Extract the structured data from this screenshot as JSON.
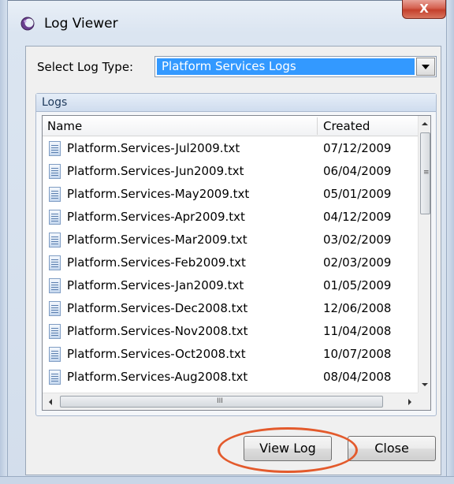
{
  "window": {
    "title": "Log Viewer",
    "close_glyph": "X"
  },
  "selector": {
    "label": "Select Log Type:",
    "selected": "Platform Services Logs"
  },
  "logs_group": {
    "title": "Logs",
    "columns": {
      "name": "Name",
      "created": "Created"
    },
    "rows": [
      {
        "name": "Platform.Services-Jul2009.txt",
        "created": "07/12/2009"
      },
      {
        "name": "Platform.Services-Jun2009.txt",
        "created": "06/04/2009"
      },
      {
        "name": "Platform.Services-May2009.txt",
        "created": "05/01/2009"
      },
      {
        "name": "Platform.Services-Apr2009.txt",
        "created": "04/12/2009"
      },
      {
        "name": "Platform.Services-Mar2009.txt",
        "created": "03/02/2009"
      },
      {
        "name": "Platform.Services-Feb2009.txt",
        "created": "02/03/2009"
      },
      {
        "name": "Platform.Services-Jan2009.txt",
        "created": "01/05/2009"
      },
      {
        "name": "Platform.Services-Dec2008.txt",
        "created": "12/06/2008"
      },
      {
        "name": "Platform.Services-Nov2008.txt",
        "created": "11/04/2008"
      },
      {
        "name": "Platform.Services-Oct2008.txt",
        "created": "10/07/2008"
      },
      {
        "name": "Platform.Services-Aug2008.txt",
        "created": "08/04/2008"
      }
    ]
  },
  "buttons": {
    "view_log": "View Log",
    "close": "Close"
  },
  "colors": {
    "selection": "#3399ff",
    "highlight_ring": "#e35a2c",
    "close_button": "#c4402c"
  },
  "icons": {
    "app": "log-viewer-app-icon",
    "file": "text-file-icon"
  }
}
